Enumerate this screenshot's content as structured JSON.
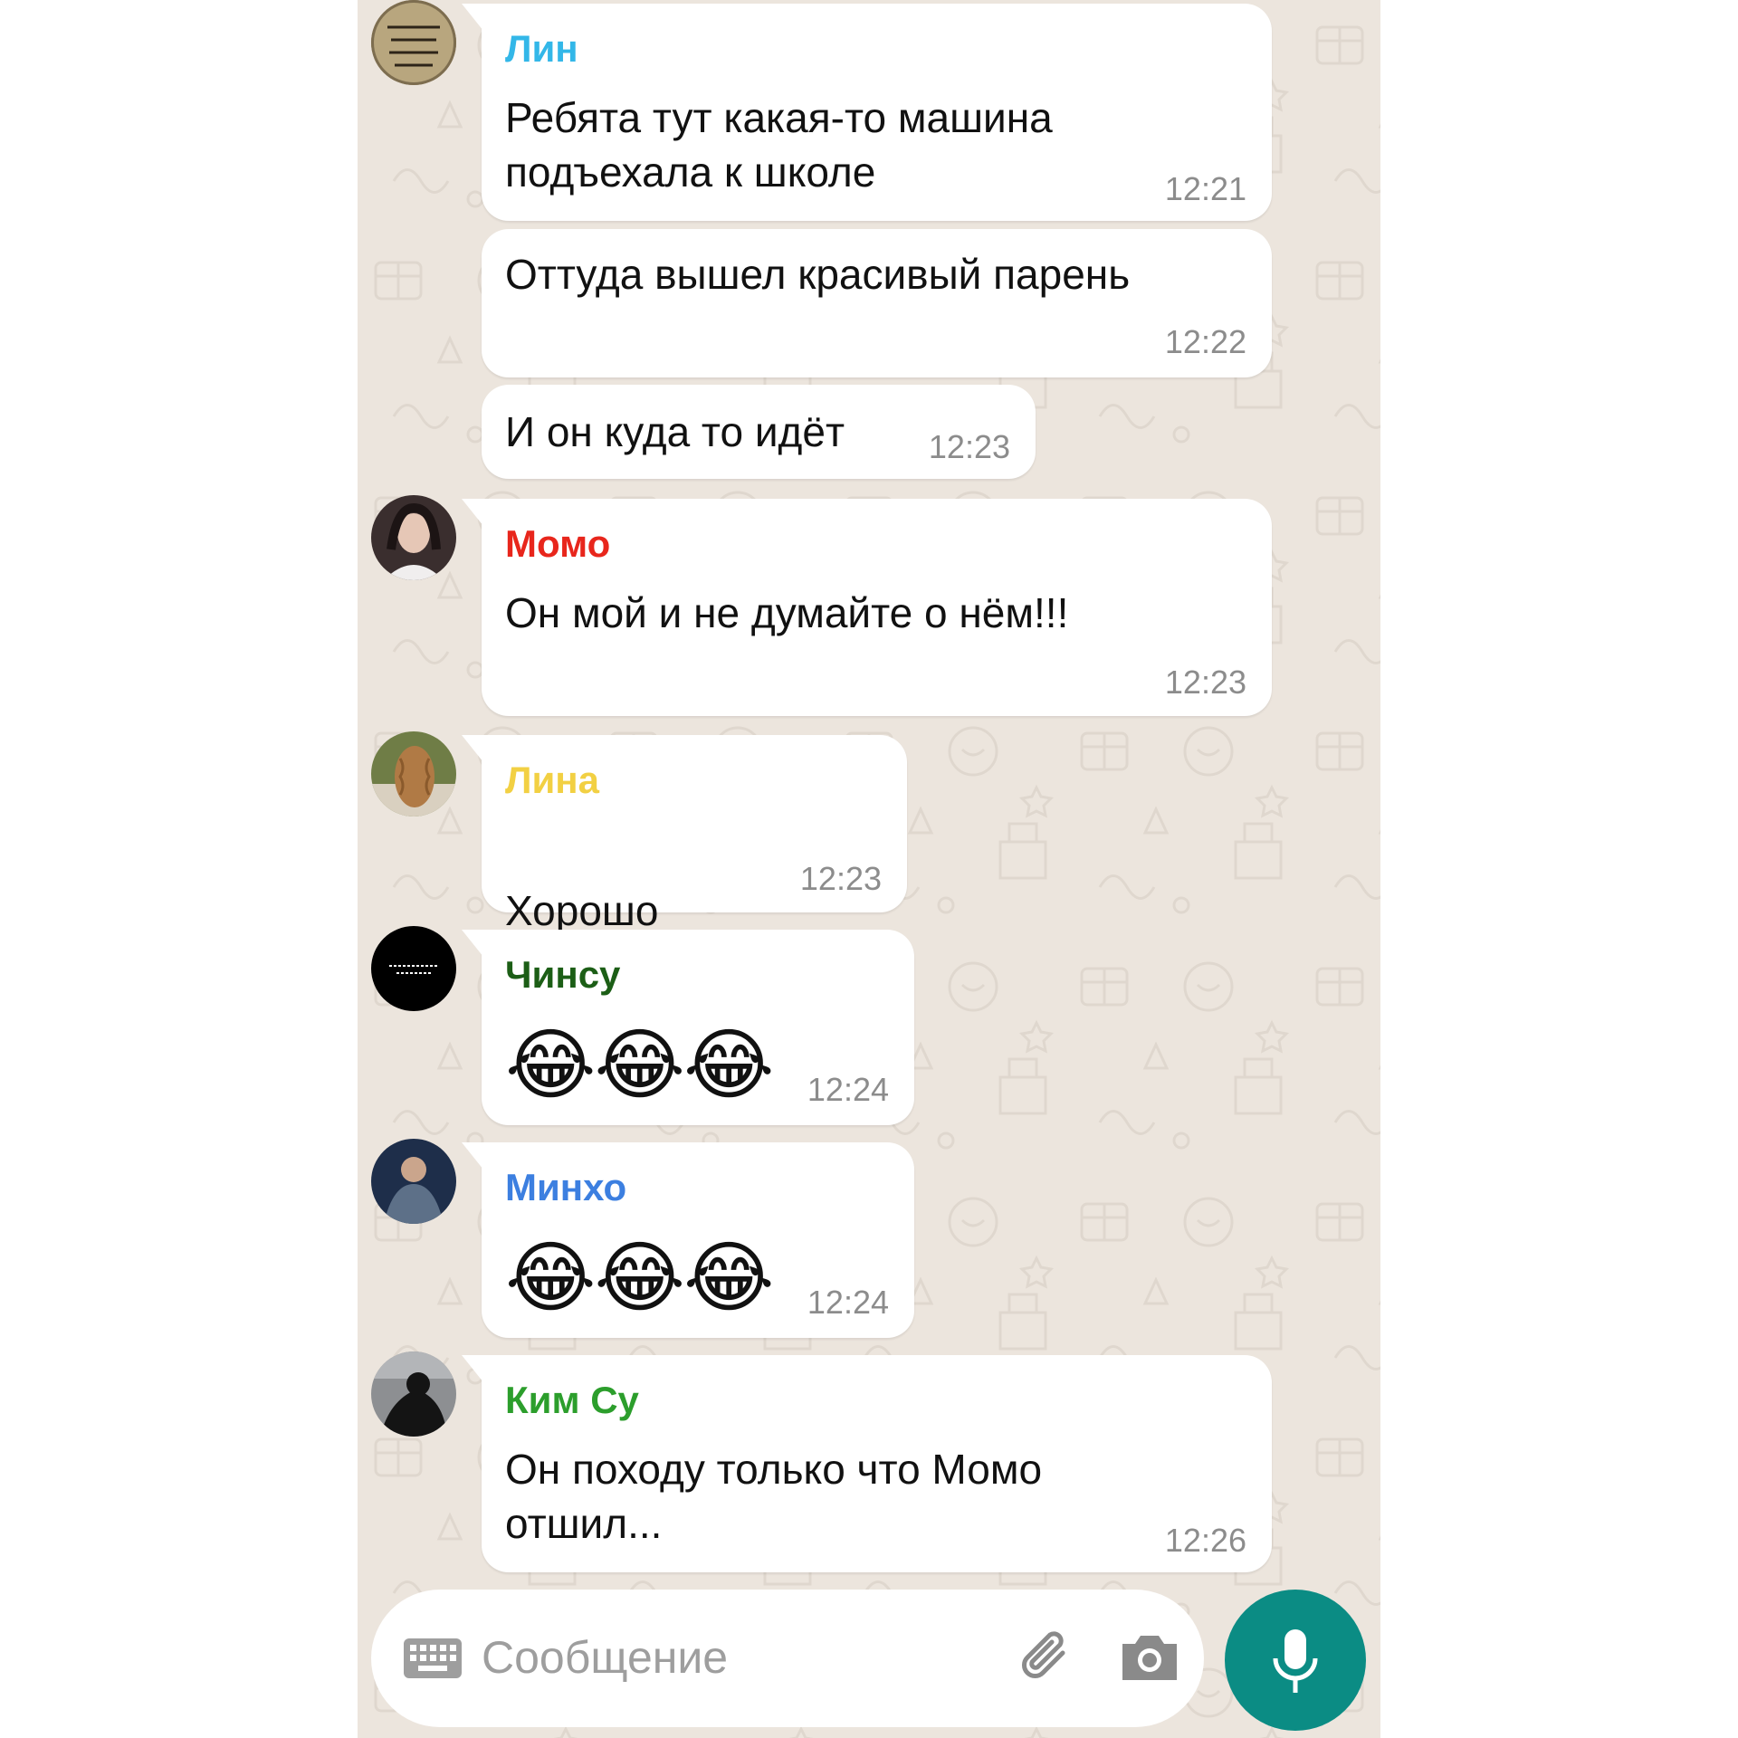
{
  "colors": {
    "wallpaper": "#ece5dd",
    "bubble": "#ffffff",
    "accent": "#0b8c84",
    "time_text": "#8c8c8c"
  },
  "messages": [
    {
      "sender": "Лин",
      "sender_color": "#33b7e8",
      "text": "Ребята тут какая-то машина\nподъехала к школе",
      "time": "12:21"
    },
    {
      "text": "Оттуда вышел красивый парень",
      "time": "12:22"
    },
    {
      "text": "И он куда то идёт",
      "time": "12:23"
    },
    {
      "sender": "Момо",
      "sender_color": "#e8261c",
      "text": "Он мой и не думайте о нём!!!",
      "time": "12:23"
    },
    {
      "sender": "Лина",
      "sender_color": "#f2d043",
      "text": "Хорошо",
      "emoji": "😂",
      "time": "12:23"
    },
    {
      "sender": "Чинсу",
      "sender_color": "#1c5e16",
      "emoji": "😂😂😂",
      "time": "12:24"
    },
    {
      "sender": "Минхо",
      "sender_color": "#3c7fe0",
      "emoji": "😂😂😂",
      "time": "12:24"
    },
    {
      "sender": "Ким Су",
      "sender_color": "#2c9e2c",
      "text": "Он походу только что Момо\nотшил...",
      "time": "12:26"
    }
  ],
  "avatars": {
    "lin": {
      "kind": "handwritten-note-photo",
      "lettering": "Девочки должна не играть, а худеть"
    },
    "momo": {
      "kind": "portrait-photo"
    },
    "lina": {
      "kind": "curly-hair-photo"
    },
    "chinsu": {
      "kind": "black-text-image"
    },
    "minho": {
      "kind": "person-photo"
    },
    "kimsu": {
      "kind": "silhouette-photo"
    }
  },
  "composer": {
    "placeholder": "Сообщение",
    "icons": {
      "keyboard": "keyboard-icon",
      "attach": "paperclip-icon",
      "camera": "camera-icon",
      "mic": "microphone-icon"
    }
  }
}
